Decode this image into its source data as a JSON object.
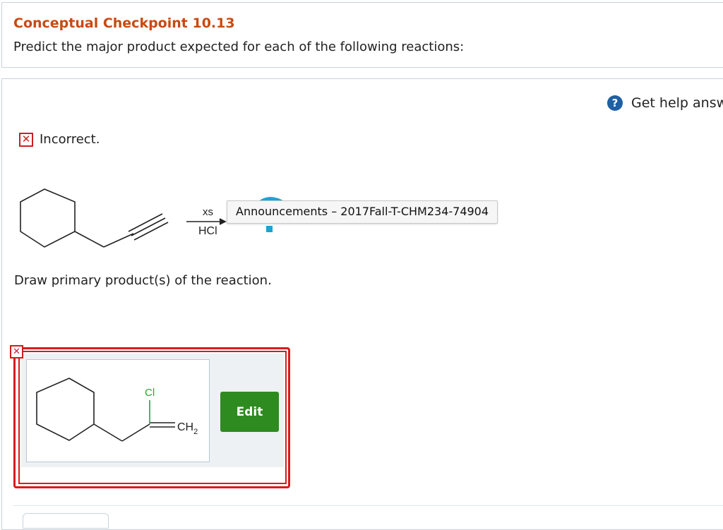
{
  "header": {
    "title": "Conceptual Checkpoint 10.13",
    "instructions": "Predict the major product expected for each of the following reactions:"
  },
  "help": {
    "icon": "question-circle-icon",
    "label": "Get help answ"
  },
  "feedback": {
    "status_icon": "close-icon",
    "status_text": "Incorrect."
  },
  "reaction": {
    "reagent_above": "xs",
    "reagent_below": "HCl"
  },
  "tooltip": {
    "text": "Announcements – 2017Fall-T-CHM234-74904"
  },
  "question": {
    "prompt": "Draw primary product(s) of the reaction."
  },
  "answer": {
    "atom_label_cl": "Cl",
    "atom_label_ch": "CH",
    "atom_label_sub": "2",
    "edit_label": "Edit",
    "status_icon": "close-icon"
  },
  "colors": {
    "title": "#c84a12",
    "error": "#d81c1c",
    "edit_button": "#2e8b1f",
    "help_icon": "#1f5fa3",
    "chlorine": "#1fa82a"
  }
}
